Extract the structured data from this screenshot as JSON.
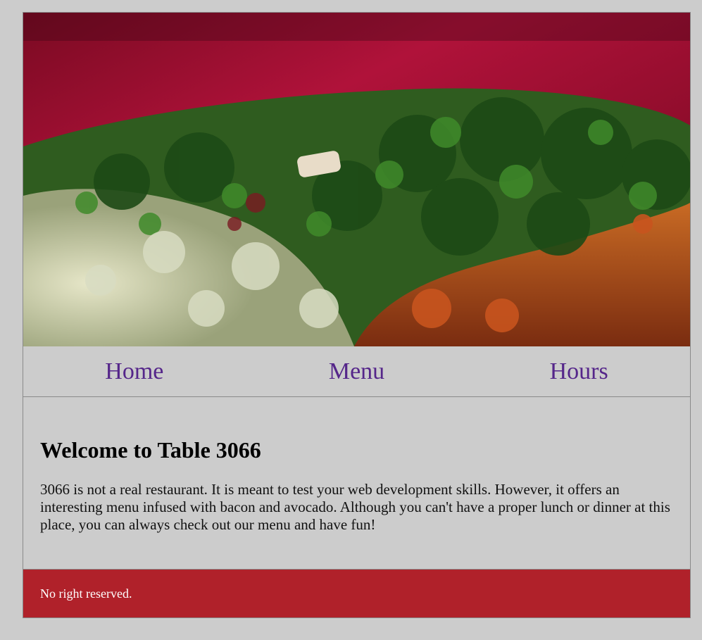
{
  "hero": {
    "image_alt": "Herb and greens frittata on a red background",
    "colors": {
      "background": "#a0102e",
      "greens": "#1f5a1a",
      "egg": "#d9dcc0",
      "crust": "#b2501c"
    }
  },
  "nav": {
    "items": [
      {
        "label": "Home"
      },
      {
        "label": "Menu"
      },
      {
        "label": "Hours"
      }
    ],
    "link_color": "#55268a"
  },
  "main": {
    "title": "Welcome to Table 3066",
    "body": "3066 is not a real restaurant. It is meant to test your web development skills. However, it offers an interesting menu infused with bacon and avocado. Although you can't have a proper lunch or dinner at this place, you can always check out our menu and have fun!"
  },
  "footer": {
    "text": "No right reserved.",
    "background": "#b0212a"
  }
}
